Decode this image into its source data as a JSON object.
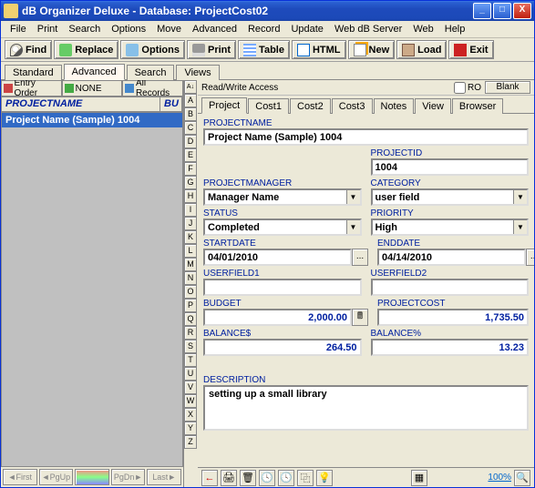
{
  "title": "dB Organizer Deluxe - Database: ProjectCost02",
  "menu": [
    "File",
    "Print",
    "Search",
    "Options",
    "Move",
    "Advanced",
    "Record",
    "Update",
    "Web dB Server",
    "Web",
    "Help"
  ],
  "toolbar": {
    "find": "Find",
    "replace": "Replace",
    "options": "Options",
    "print": "Print",
    "table": "Table",
    "html": "HTML",
    "new": "New",
    "load": "Load",
    "exit": "Exit"
  },
  "viewtabs": {
    "standard": "Standard",
    "advanced": "Advanced",
    "search": "Search",
    "views": "Views"
  },
  "leftfilter": {
    "entryorder": "Entry Order",
    "none": "NONE",
    "allrecords": "All Records"
  },
  "listhead": {
    "name": "PROJECTNAME",
    "col2": "BU"
  },
  "listrow": "Project Name (Sample) 1004",
  "nav": {
    "first": "First",
    "pgup": "PgUp",
    "pgdn": "PgDn",
    "last": "Last"
  },
  "az": [
    "A",
    "B",
    "C",
    "D",
    "E",
    "F",
    "G",
    "H",
    "I",
    "J",
    "K",
    "L",
    "M",
    "N",
    "O",
    "P",
    "Q",
    "R",
    "S",
    "T",
    "U",
    "V",
    "W",
    "X",
    "Y",
    "Z"
  ],
  "rw": {
    "access": "Read/Write Access",
    "ro": "RO",
    "blank": "Blank"
  },
  "formtabs": [
    "Project",
    "Cost1",
    "Cost2",
    "Cost3",
    "Notes",
    "View",
    "Browser"
  ],
  "labels": {
    "projectname": "PROJECTNAME",
    "projectid": "PROJECTID",
    "projectmanager": "PROJECTMANAGER",
    "category": "CATEGORY",
    "status": "STATUS",
    "priority": "PRIORITY",
    "startdate": "STARTDATE",
    "enddate": "ENDDATE",
    "userfield1": "USERFIELD1",
    "userfield2": "USERFIELD2",
    "budget": "BUDGET",
    "projectcost": "PROJECTCOST",
    "balances": "BALANCE$",
    "balancep": "BALANCE%",
    "description": "DESCRIPTION"
  },
  "values": {
    "projectname": "Project Name (Sample) 1004",
    "projectid": "1004",
    "projectmanager": "Manager Name",
    "category": "user field",
    "status": "Completed",
    "priority": "High",
    "startdate": "04/01/2010",
    "enddate": "04/14/2010",
    "userfield1": "",
    "userfield2": "",
    "budget": "2,000.00",
    "projectcost": "1,735.50",
    "balances": "264.50",
    "balancep": "13.23",
    "description": "setting up a small library"
  },
  "zoom": "100%",
  "datebtn": "..."
}
